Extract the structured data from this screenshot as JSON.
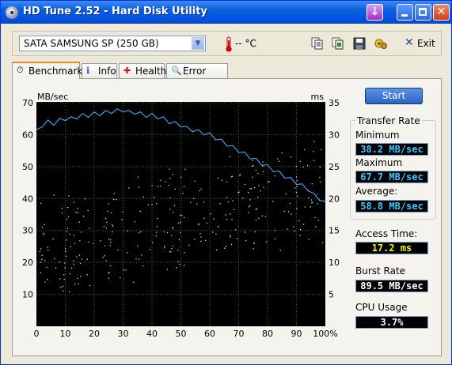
{
  "window": {
    "title": "HD Tune 2.52 - Hard Disk Utility"
  },
  "toolbar": {
    "drive": "SATA  SAMSUNG SP (250 GB)",
    "temperature": "-- °C",
    "exit_label": "Exit",
    "icons": [
      "copy-text-icon",
      "copy-screen-icon",
      "save-icon",
      "options-icon"
    ]
  },
  "tabs": [
    {
      "label": "Benchmark",
      "icon": "stopwatch-icon",
      "active": true
    },
    {
      "label": "Info",
      "icon": "info-icon"
    },
    {
      "label": "Health",
      "icon": "health-cross-icon"
    },
    {
      "label": "Error Scan",
      "icon": "magnifier-icon"
    }
  ],
  "benchmark": {
    "start_label": "Start",
    "transfer_rate_title": "Transfer Rate",
    "minimum_label": "Minimum",
    "minimum_value": "38.2 MB/sec",
    "maximum_label": "Maximum",
    "maximum_value": "67.7 MB/sec",
    "average_label": "Average:",
    "average_value": "58.8 MB/sec",
    "access_time_label": "Access Time:",
    "access_time_value": "17.2 ms",
    "burst_rate_label": "Burst Rate",
    "burst_rate_value": "89.5 MB/sec",
    "cpu_usage_label": "CPU Usage",
    "cpu_usage_value": "3.7%"
  },
  "colors": {
    "transfer_line": "#4aa8f0",
    "access_dots": "#e8e840",
    "grid": "#2a6a2a",
    "chart_bg": "#000000"
  },
  "chart_data": {
    "type": "line",
    "y_left_label": "MB/sec",
    "y_right_label": "ms",
    "y_left_ticks": [
      10,
      20,
      30,
      40,
      50,
      60,
      70
    ],
    "y_right_ticks": [
      5,
      10,
      15,
      20,
      25,
      30,
      35
    ],
    "x_ticks": [
      "0",
      "10",
      "20",
      "30",
      "40",
      "50",
      "60",
      "70",
      "80",
      "90",
      "100%"
    ],
    "ylim_left": [
      0,
      70
    ],
    "ylim_right": [
      0,
      35
    ],
    "xlim": [
      0,
      100
    ],
    "grid": true,
    "series": [
      {
        "name": "Transfer Rate",
        "x": [
          0,
          2,
          4,
          6,
          8,
          10,
          12,
          14,
          16,
          18,
          20,
          22,
          24,
          26,
          28,
          30,
          32,
          34,
          36,
          38,
          40,
          42,
          44,
          46,
          48,
          50,
          52,
          54,
          56,
          58,
          60,
          62,
          64,
          66,
          68,
          70,
          72,
          74,
          76,
          78,
          80,
          82,
          84,
          86,
          88,
          90,
          92,
          94,
          96,
          98,
          100
        ],
        "y": [
          61,
          63,
          64,
          63.5,
          64.5,
          65,
          65,
          65.5,
          66,
          66,
          66.5,
          66.5,
          67,
          67.2,
          67.5,
          67.7,
          67,
          67,
          66.5,
          66,
          66,
          65.5,
          65,
          64,
          63.5,
          63,
          62,
          61.5,
          61,
          60.5,
          60,
          59,
          58,
          57,
          56,
          55,
          54,
          53,
          52,
          51,
          50,
          49,
          48,
          47,
          46,
          45,
          44,
          43,
          41,
          40,
          38.5
        ]
      }
    ],
    "access_time_scatter": {
      "yaxis": "right_ms",
      "range_ms": [
        5,
        30
      ],
      "trend": "rises from ~12 ms at 0% to ~22 ms at 100%"
    }
  }
}
